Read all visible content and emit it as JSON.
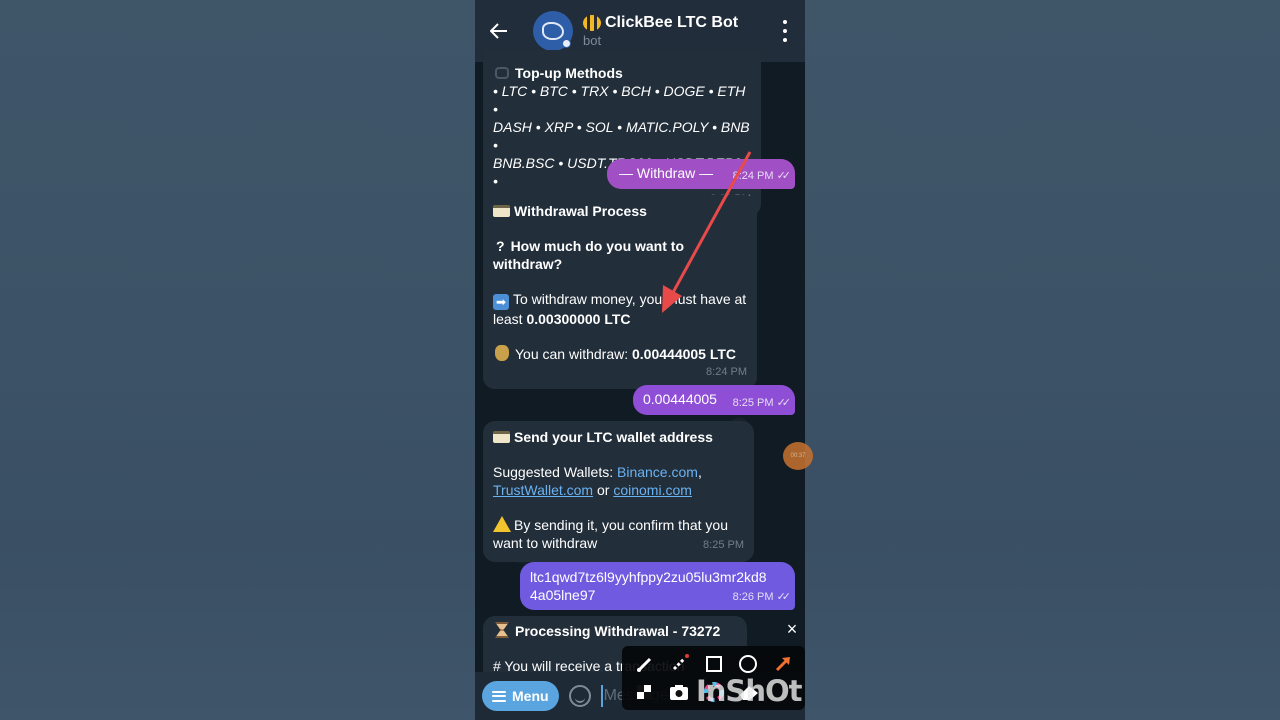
{
  "header": {
    "back_icon": "arrow-left",
    "title": "ClickBee LTC Bot",
    "subtitle": "bot",
    "more_icon": "kebab-menu"
  },
  "messages": [
    {
      "type": "incoming",
      "title": "Top-up Methods",
      "lines": [
        "• LTC • BTC • TRX • BCH • DOGE • ETH •",
        "DASH • XRP • SOL • MATIC.POLY • BNB •",
        "BNB.BSC • USDT.TRC20 • USDT.BEP20 •"
      ],
      "time": "8:23 PM"
    },
    {
      "type": "outgoing",
      "text": "— Withdraw —",
      "time": "8:24 PM",
      "status": "read"
    },
    {
      "type": "incoming",
      "title": "Withdrawal Process",
      "question": "How much do you want to withdraw?",
      "min_prefix": "To withdraw money, you must have at least ",
      "min_amount": "0.00300000 LTC",
      "avail_prefix": "You can withdraw: ",
      "avail_amount": "0.00444005 LTC",
      "time": "8:24 PM"
    },
    {
      "type": "outgoing",
      "text": "0.00444005",
      "time": "8:25 PM",
      "status": "read"
    },
    {
      "type": "incoming",
      "title": "Send your LTC wallet address",
      "wallets_prefix": "Suggested Wallets: ",
      "wallet_1": "Binance.com",
      "comma": ",",
      "wallet_2": "TrustWallet.com",
      "or": " or ",
      "wallet_3": "coinomi.com",
      "warning": "By sending it, you confirm that you want to withdraw",
      "time": "8:25 PM"
    },
    {
      "type": "outgoing",
      "text": "ltc1qwd7tz6l9yyhfppy2zu05lu3mr2kd84a05lne97",
      "line1": "ltc1qwd7tz6l9yyhfppy2zu05lu3mr2kd8",
      "line2": "4a05lne97",
      "time": "8:26 PM",
      "status": "read"
    },
    {
      "type": "incoming",
      "title": "Processing Withdrawal - 73272",
      "partial_text": "# You will receive a transaction"
    }
  ],
  "input": {
    "menu_label": "Menu",
    "placeholder": "Message"
  },
  "overlay": {
    "close_label": "×",
    "watermark": "InShOt",
    "tools": [
      "brush",
      "magic-brush",
      "rectangle",
      "circle",
      "arrow",
      "mosaic",
      "camera",
      "color-picker",
      "eraser"
    ],
    "float_bubble_text": "00:37"
  },
  "colors": {
    "outgoing_withdraw": "#a14fc4",
    "outgoing_amount": "#8e4fd6",
    "outgoing_address": "#6f5ae0",
    "incoming": "#222e3a",
    "link": "#6ab2f2",
    "annotation_arrow": "#e84a4a",
    "menu_button": "#5aa5e0"
  }
}
